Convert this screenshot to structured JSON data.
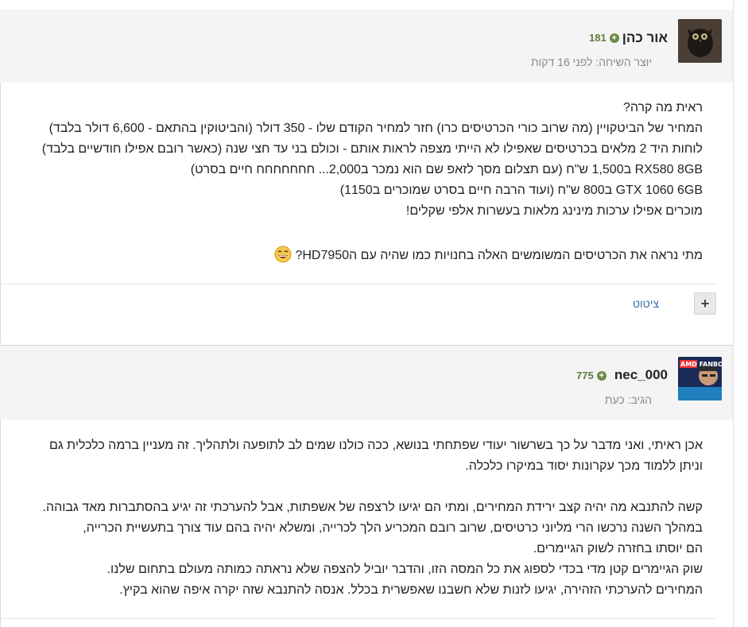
{
  "posts": [
    {
      "author": "אור כהן",
      "reputation": "181",
      "meta": "יוצר השיחה: לפני 16 דקות",
      "lines": [
        "ראית מה קרה?",
        "המחיר של הביטקויין (מה שרוב כורי הכרטיסים כרו) חזר למחיר הקודם שלו - 350 דולר (והביטוקין בהתאם - 6,600 דולר בלבד)",
        "לוחות היד 2 מלאים בכרטיסים שאפילו לא הייתי מצפה לראות אותם - וכולם בני עד חצי שנה (כאשר רובם אפילו חודשיים בלבד)",
        "RX580 8GB ב1,500 ש\"ח (עם תצלום מסך לזאפ שם הוא נמכר ב2,000... חחחחחחח חיים בסרט)",
        "GTX 1060 6GB ב800 ש\"ח (ועוד הרבה חיים בסרט שמוכרים ב1150)",
        "מוכרים אפילו ערכות מינינג מלאות בעשרות אלפי שקלים!",
        "",
        "מתי נראה את הכרטיסים המשומשים האלה בחנויות כמו שהיה עם הHD7950?"
      ],
      "quote_label": "ציטוט",
      "emoji_icon": "laughing-emoji-icon"
    },
    {
      "author": "nec_000",
      "reputation": "775",
      "meta": "הגיב: כעת",
      "avatar_text": "AMD FANBOY",
      "lines": [
        "אכן ראיתי, ואני מדבר על כך בשרשור יעודי שפתחתי בנושא, ככה כולנו שמים לב לתופעה ולתהליך. זה מעניין ברמה כלכלית גם",
        "וניתן ללמוד מכך עקרונות יסוד במיקרו כלכלה.",
        "",
        "קשה להתנבא מה יהיה קצב ירידת המחירים, ומתי הם יגיעו לרצפה של אשפתות, אבל להערכתי זה יגיע בהסתברות מאד גבוהה.",
        "במהלך השנה נרכשו הרי מליוני כרטיסים, שרוב רובם המכריע הלך לכרייה, ומשלא יהיה בהם עוד צורך בתעשיית הכרייה,",
        "הם יוסתו בחזרה לשוק הגיימרים.",
        "שוק הגיימרים קטן מדי בכדי לספוג את כל המסה הזו, והדבר יוביל להצפה שלא נראתה כמותה מעולם בתחום שלנו.",
        "המחירים להערכתי הזהירה, יגיעו לזנות שלא חשבנו שאפשרית בכלל. אנסה להתנבא שזה יקרה איפה שהוא בקיץ."
      ]
    }
  ]
}
